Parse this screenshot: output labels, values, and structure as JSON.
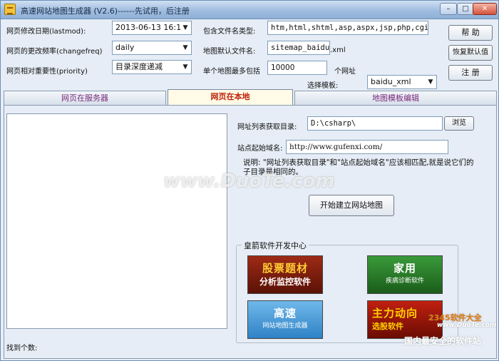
{
  "window": {
    "title": "高速网站地图生成器 (V2.6)------先试用，后注册",
    "controls": {
      "minimize": "–",
      "maximize": "□",
      "close": "✕"
    }
  },
  "settings": {
    "lastmod_label": "网页修改日期(lastmod):",
    "lastmod_value": "2013-06-13 16:1",
    "changefreq_label": "网页的更改频率(changefreq)",
    "changefreq_value": "daily",
    "priority_label": "网页相对重要性(priority)",
    "priority_value": "目录深度递减",
    "filetypes_label": "包含文件名类型:",
    "filetypes_value": "htm,html,shtml,asp,aspx,jsp,php,cgi",
    "default_name_label": "地图默认文件名:",
    "default_name_value": "sitemap_baidu",
    "default_name_ext": ".xml",
    "max_urls_label": "单个地图最多包括",
    "max_urls_value": "10000",
    "max_urls_unit": "个网址",
    "template_label": "选择模板:",
    "template_value": "baidu_xml"
  },
  "side_buttons": {
    "help": "帮 助",
    "restore": "恢复默认值",
    "register": "注 册"
  },
  "tabs": [
    {
      "label": "网页在服务器"
    },
    {
      "label": "网页在本地"
    },
    {
      "label": "地图模板编辑"
    }
  ],
  "local": {
    "dir_label": "网址列表获取目录:",
    "dir_value": "D:\\csharp\\",
    "browse": "浏览",
    "domain_label": "站点起始域名:",
    "domain_value": "http://www.gufenxi.com/",
    "note": "说明: \"网址列表获取目录\"和\"站点起始域名\"应该相匹配,就是说它们的子目录是相同的。",
    "start_button": "开始建立网站地图",
    "found_label": "找到个数:"
  },
  "dev_center": {
    "title": "皇箭软件开发中心",
    "ads": [
      {
        "line1": "股票题材",
        "line2": "分析监控软件"
      },
      {
        "line1": "家用",
        "line2": "疾病诊断软件"
      },
      {
        "line1": "高速",
        "line2": "网站地图生成器"
      },
      {
        "line1": "主力动向",
        "line2": "选股软件"
      }
    ]
  },
  "watermarks": {
    "center": "www.DuoTe.com",
    "corner_brand": "2345软件大全",
    "corner_url": "www.DuoTe.com",
    "footer": "国内最安全的软件站"
  }
}
